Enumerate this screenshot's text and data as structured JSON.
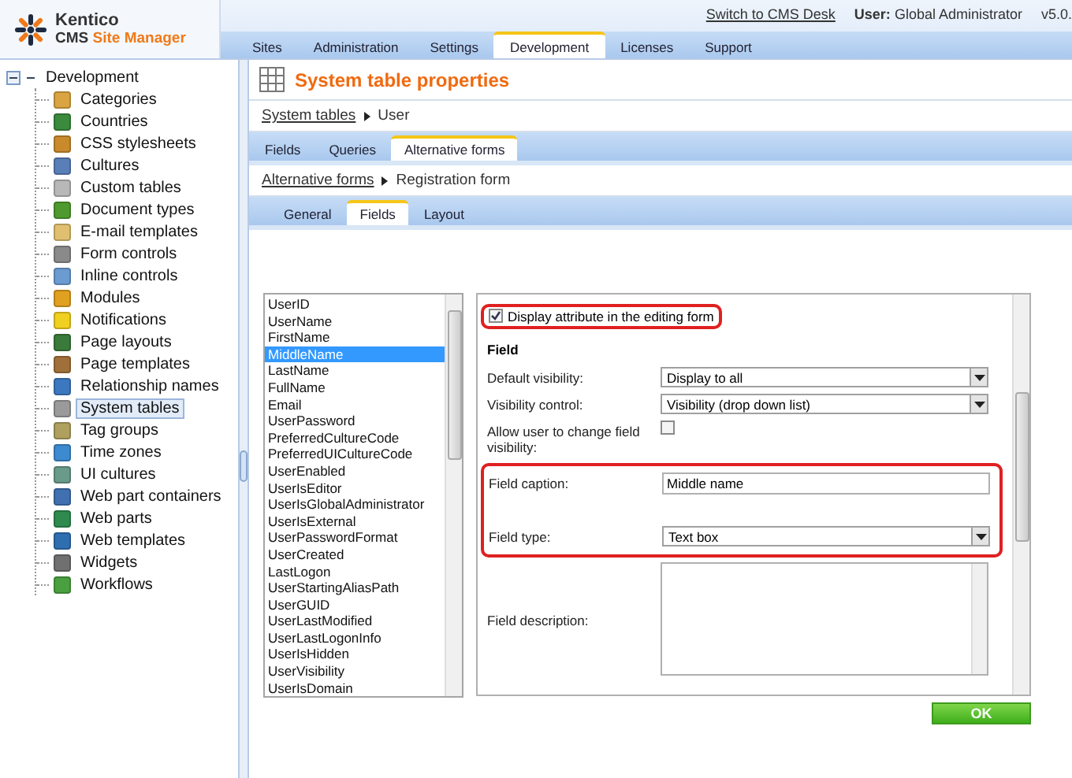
{
  "header": {
    "logo_name": "Kentico",
    "logo_product": "CMS",
    "logo_product_name": "Site Manager",
    "switch_link": "Switch to CMS Desk",
    "user_label": "User:",
    "user_name": "Global Administrator",
    "version": "v5.0."
  },
  "main_tabs": [
    {
      "label": "Sites",
      "selected": false
    },
    {
      "label": "Administration",
      "selected": false
    },
    {
      "label": "Settings",
      "selected": false
    },
    {
      "label": "Development",
      "selected": true
    },
    {
      "label": "Licenses",
      "selected": false
    },
    {
      "label": "Support",
      "selected": false
    }
  ],
  "tree": {
    "label": "Development",
    "expanded": true,
    "children": [
      {
        "label": "Categories",
        "selected": false,
        "color": "#d9a441"
      },
      {
        "label": "Countries",
        "selected": false,
        "color": "#3b8a3e"
      },
      {
        "label": "CSS stylesheets",
        "selected": false,
        "color": "#c98a2c"
      },
      {
        "label": "Cultures",
        "selected": false,
        "color": "#5a7fb8"
      },
      {
        "label": "Custom tables",
        "selected": false,
        "color": "#b8b8b8"
      },
      {
        "label": "Document types",
        "selected": false,
        "color": "#4f9a2f"
      },
      {
        "label": "E-mail templates",
        "selected": false,
        "color": "#e0c070"
      },
      {
        "label": "Form controls",
        "selected": false,
        "color": "#8a8a8a"
      },
      {
        "label": "Inline controls",
        "selected": false,
        "color": "#6c9bd2"
      },
      {
        "label": "Modules",
        "selected": false,
        "color": "#e0a020"
      },
      {
        "label": "Notifications",
        "selected": false,
        "color": "#f0d020"
      },
      {
        "label": "Page layouts",
        "selected": false,
        "color": "#3a7a3a"
      },
      {
        "label": "Page templates",
        "selected": false,
        "color": "#a0703a"
      },
      {
        "label": "Relationship names",
        "selected": false,
        "color": "#3c78c0"
      },
      {
        "label": "System tables",
        "selected": true,
        "color": "#9a9a9a"
      },
      {
        "label": "Tag groups",
        "selected": false,
        "color": "#b0a060"
      },
      {
        "label": "Time zones",
        "selected": false,
        "color": "#3d8ad0"
      },
      {
        "label": "UI cultures",
        "selected": false,
        "color": "#6a9a8a"
      },
      {
        "label": "Web part containers",
        "selected": false,
        "color": "#4070b0"
      },
      {
        "label": "Web parts",
        "selected": false,
        "color": "#2e8a4e"
      },
      {
        "label": "Web templates",
        "selected": false,
        "color": "#2f6fb0"
      },
      {
        "label": "Widgets",
        "selected": false,
        "color": "#707070"
      },
      {
        "label": "Workflows",
        "selected": false,
        "color": "#4aa040"
      }
    ]
  },
  "page_title": "System table properties",
  "breadcrumb": {
    "link": "System tables",
    "current": "User"
  },
  "tabs": [
    {
      "label": "Fields",
      "selected": false
    },
    {
      "label": "Queries",
      "selected": false
    },
    {
      "label": "Alternative forms",
      "selected": true
    }
  ],
  "breadcrumb_2": {
    "link": "Alternative forms",
    "current": "Registration form"
  },
  "sub_tabs": [
    {
      "label": "General",
      "selected": false
    },
    {
      "label": "Fields",
      "selected": true
    },
    {
      "label": "Layout",
      "selected": false
    }
  ],
  "field_list": [
    {
      "label": "UserID",
      "selected": false
    },
    {
      "label": "UserName",
      "selected": false
    },
    {
      "label": "FirstName",
      "selected": false
    },
    {
      "label": "MiddleName",
      "selected": true
    },
    {
      "label": "LastName",
      "selected": false
    },
    {
      "label": "FullName",
      "selected": false
    },
    {
      "label": "Email",
      "selected": false
    },
    {
      "label": "UserPassword",
      "selected": false
    },
    {
      "label": "PreferredCultureCode",
      "selected": false
    },
    {
      "label": "PreferredUICultureCode",
      "selected": false
    },
    {
      "label": "UserEnabled",
      "selected": false
    },
    {
      "label": "UserIsEditor",
      "selected": false
    },
    {
      "label": "UserIsGlobalAdministrator",
      "selected": false
    },
    {
      "label": "UserIsExternal",
      "selected": false
    },
    {
      "label": "UserPasswordFormat",
      "selected": false
    },
    {
      "label": "UserCreated",
      "selected": false
    },
    {
      "label": "LastLogon",
      "selected": false
    },
    {
      "label": "UserStartingAliasPath",
      "selected": false
    },
    {
      "label": "UserGUID",
      "selected": false
    },
    {
      "label": "UserLastModified",
      "selected": false
    },
    {
      "label": "UserLastLogonInfo",
      "selected": false
    },
    {
      "label": "UserIsHidden",
      "selected": false
    },
    {
      "label": "UserVisibility",
      "selected": false
    },
    {
      "label": "UserIsDomain",
      "selected": false
    }
  ],
  "display_attribute": {
    "label": "Display attribute in the editing form",
    "checked": true,
    "highlighted": true
  },
  "section_title": "Field",
  "rows": [
    {
      "kind": "select",
      "label": "Default visibility:",
      "value": "Display to all",
      "highlighted": false
    },
    {
      "kind": "select",
      "label": "Visibility control:",
      "value": "Visibility (drop down list)",
      "highlighted": false
    },
    {
      "kind": "checkbox",
      "label": "Allow user to change field visibility:",
      "checked": false,
      "highlighted": false
    },
    {
      "kind": "text",
      "label": "Field caption:",
      "value": "Middle name",
      "highlighted": true
    },
    {
      "kind": "select",
      "label": "Field type:",
      "value": "Text box",
      "highlighted": true
    },
    {
      "kind": "textarea",
      "label": "Field description:",
      "highlighted": false
    }
  ],
  "ok_button": "OK"
}
